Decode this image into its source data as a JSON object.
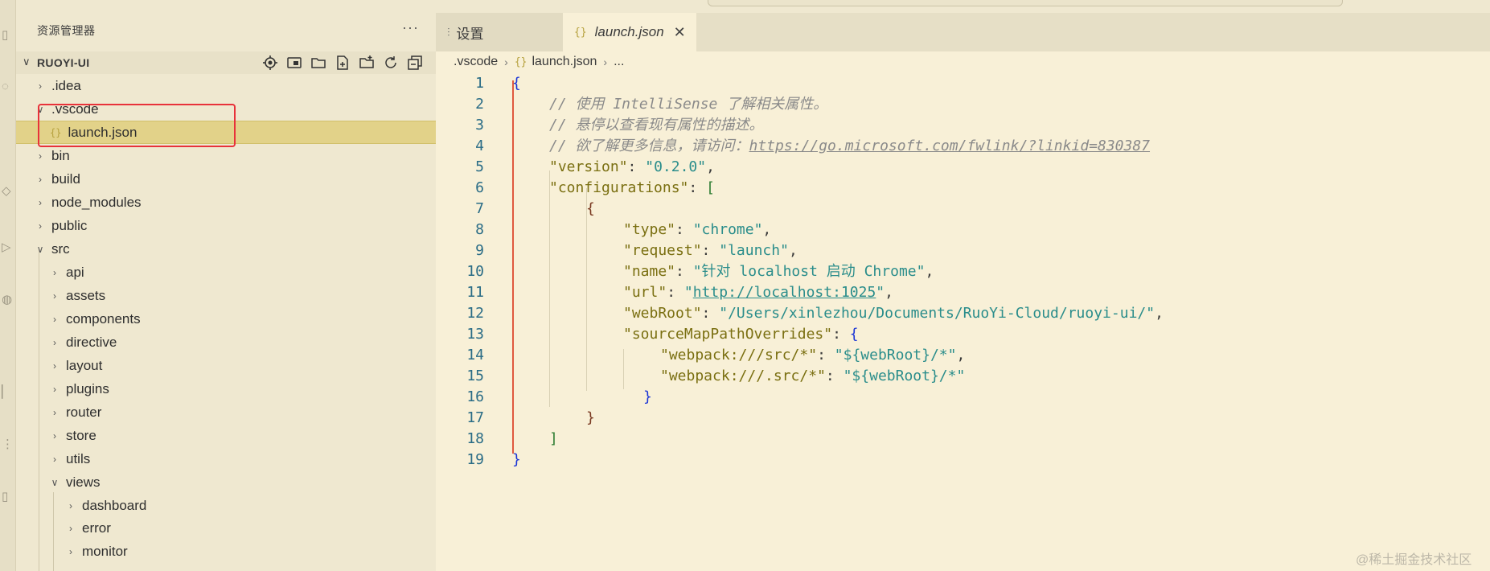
{
  "explorer": {
    "title": "资源管理器",
    "more_label": "···",
    "project": "RUOYI-UI",
    "project_chevron": "∨",
    "tree": [
      {
        "label": ".idea",
        "chev": "›",
        "icon": ""
      },
      {
        "label": ".vscode",
        "chev": "∨",
        "icon": ""
      },
      {
        "label": "launch.json",
        "chev": "",
        "icon": "{}"
      },
      {
        "label": "bin",
        "chev": "›",
        "icon": ""
      },
      {
        "label": "build",
        "chev": "›",
        "icon": ""
      },
      {
        "label": "node_modules",
        "chev": "›",
        "icon": ""
      },
      {
        "label": "public",
        "chev": "›",
        "icon": ""
      },
      {
        "label": "src",
        "chev": "∨",
        "icon": ""
      },
      {
        "label": "api",
        "chev": "›",
        "icon": ""
      },
      {
        "label": "assets",
        "chev": "›",
        "icon": ""
      },
      {
        "label": "components",
        "chev": "›",
        "icon": ""
      },
      {
        "label": "directive",
        "chev": "›",
        "icon": ""
      },
      {
        "label": "layout",
        "chev": "›",
        "icon": ""
      },
      {
        "label": "plugins",
        "chev": "›",
        "icon": ""
      },
      {
        "label": "router",
        "chev": "›",
        "icon": ""
      },
      {
        "label": "store",
        "chev": "›",
        "icon": ""
      },
      {
        "label": "utils",
        "chev": "›",
        "icon": ""
      },
      {
        "label": "views",
        "chev": "∨",
        "icon": ""
      },
      {
        "label": "dashboard",
        "chev": "›",
        "icon": ""
      },
      {
        "label": "error",
        "chev": "›",
        "icon": ""
      },
      {
        "label": "monitor",
        "chev": "›",
        "icon": ""
      }
    ]
  },
  "tabs": {
    "settings": {
      "icon": "⫶",
      "label": "设置"
    },
    "launch": {
      "icon": "{}",
      "label": "launch.json",
      "close": "✕"
    }
  },
  "breadcrumb": {
    "folder": ".vscode",
    "sep": "›",
    "file_icon": "{}",
    "file": "launch.json",
    "more": "..."
  },
  "code": {
    "lines": [
      "{",
      "// 使用 IntelliSense 了解相关属性。",
      "// 悬停以查看现有属性的描述。",
      "// 欲了解更多信息，请访问：",
      "\"version\"",
      ": ",
      "\"0.2.0\"",
      ",",
      "\"configurations\"",
      ": ",
      "["
    ],
    "comment_link": "https://go.microsoft.com/fwlink/?linkid=830387",
    "version_key": "\"version\"",
    "version_val": "\"0.2.0\"",
    "configurations_key": "\"configurations\"",
    "type_key": "\"type\"",
    "type_val": "\"chrome\"",
    "request_key": "\"request\"",
    "request_val": "\"launch\"",
    "name_key": "\"name\"",
    "name_val": "\"针对 localhost 启动 Chrome\"",
    "url_key": "\"url\"",
    "url_val": "http://localhost:1025",
    "webroot_key": "\"webRoot\"",
    "webroot_val": "\"/Users/xinlezhou/Documents/RuoYi-Cloud/ruoyi-ui/\"",
    "smpo_key": "\"sourceMapPathOverrides\"",
    "wp1_key": "\"webpack:///src/*\"",
    "wp1_val": "\"${webRoot}/*\"",
    "wp2_key": "\"webpack:///.src/*\"",
    "wp2_val": "\"${webRoot}/*\"",
    "line_numbers": [
      "1",
      "2",
      "3",
      "4",
      "5",
      "6",
      "7",
      "8",
      "9",
      "10",
      "11",
      "12",
      "13",
      "14",
      "15",
      "16",
      "17",
      "18",
      "19"
    ]
  },
  "watermark": "@稀土掘金技术社区"
}
